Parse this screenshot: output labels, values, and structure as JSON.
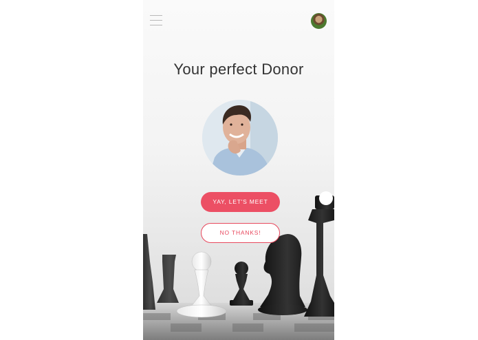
{
  "header": {
    "menu_icon": "hamburger-menu-icon",
    "avatar_icon": "user-avatar"
  },
  "main": {
    "title": "Your perfect Donor",
    "donor_photo": "donor-portrait"
  },
  "actions": {
    "accept_label": "YAY, LET'S MEET",
    "decline_label": "NO THANKS!"
  },
  "colors": {
    "accent": "#ec4f64",
    "title_text": "#333333",
    "background": "#f3f3f3"
  }
}
